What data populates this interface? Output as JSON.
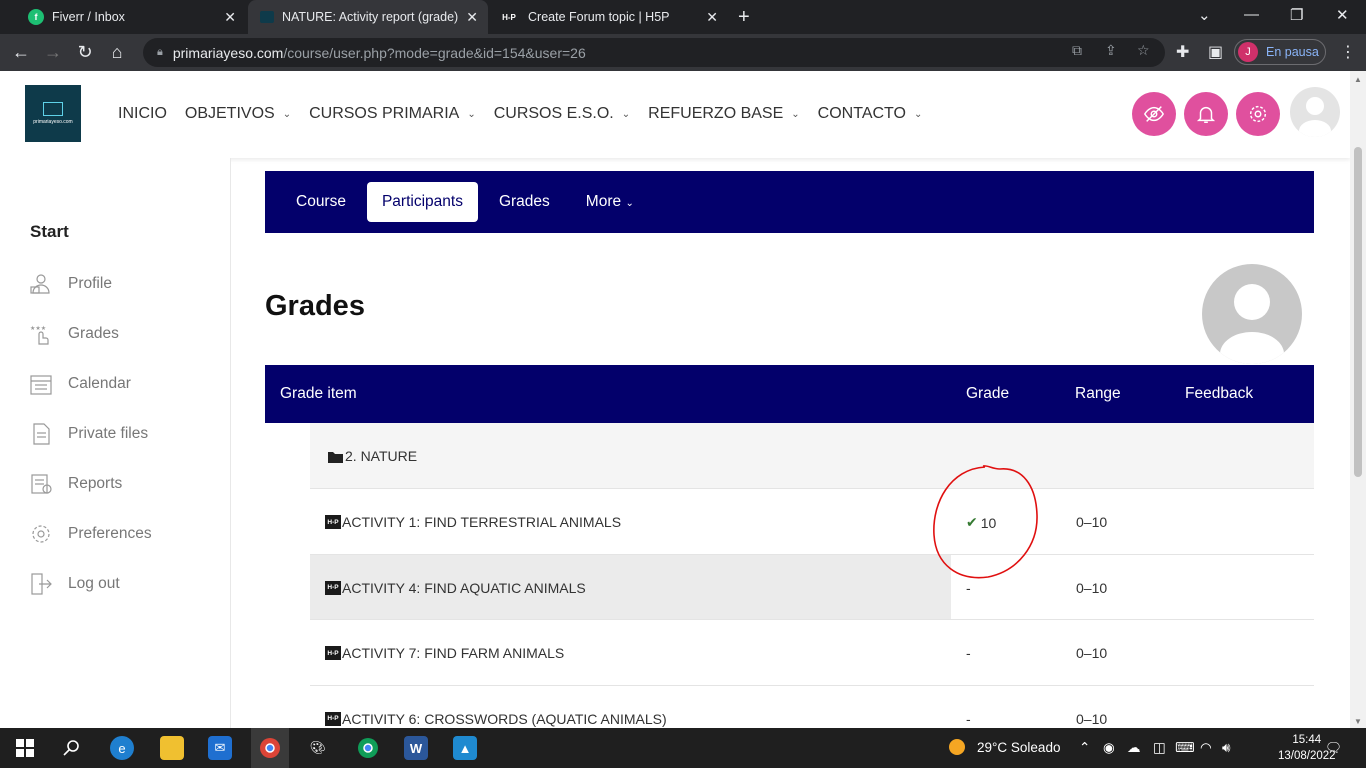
{
  "browser": {
    "tabs": [
      {
        "title": "Fiverr / Inbox",
        "favicon": "fi"
      },
      {
        "title": "NATURE: Activity report (grade)",
        "favicon": "site"
      },
      {
        "title": "Create Forum topic | H5P",
        "favicon": "H-P"
      }
    ],
    "url_host": "primariayeso.com",
    "url_path": "/course/user.php?mode=grade&id=154&user=26",
    "profile_initial": "J",
    "profile_status": "En pausa"
  },
  "site": {
    "logo_text": "primariayeso.com",
    "nav": [
      {
        "label": "INICIO",
        "has_menu": false
      },
      {
        "label": "OBJETIVOS",
        "has_menu": true
      },
      {
        "label": "CURSOS PRIMARIA",
        "has_menu": true
      },
      {
        "label": "CURSOS E.S.O.",
        "has_menu": true
      },
      {
        "label": "REFUERZO BASE",
        "has_menu": true
      },
      {
        "label": "CONTACTO",
        "has_menu": true
      }
    ],
    "accent_color": "#e0509e"
  },
  "sidebar": {
    "heading": "Start",
    "items": [
      {
        "label": "Profile",
        "icon": "profile-icon"
      },
      {
        "label": "Grades",
        "icon": "grades-icon"
      },
      {
        "label": "Calendar",
        "icon": "calendar-icon"
      },
      {
        "label": "Private files",
        "icon": "file-icon"
      },
      {
        "label": "Reports",
        "icon": "reports-icon"
      },
      {
        "label": "Preferences",
        "icon": "gear-icon"
      },
      {
        "label": "Log out",
        "icon": "logout-icon"
      }
    ]
  },
  "secondary_nav": {
    "items": [
      {
        "label": "Course",
        "active": false
      },
      {
        "label": "Participants",
        "active": true
      },
      {
        "label": "Grades",
        "active": false
      },
      {
        "label": "More",
        "active": false
      }
    ],
    "color": "#03006b"
  },
  "page": {
    "title": "Grades"
  },
  "grade_table": {
    "headers": {
      "item": "Grade item",
      "grade": "Grade",
      "range": "Range",
      "feedback": "Feedback"
    },
    "category": "2. NATURE",
    "rows": [
      {
        "name": "ACTIVITY 1: FIND TERRESTRIAL ANIMALS",
        "grade": "10",
        "graded": true,
        "range": "0–10"
      },
      {
        "name": "ACTIVITY 4: FIND AQUATIC ANIMALS",
        "grade": "-",
        "graded": false,
        "range": "0–10"
      },
      {
        "name": "ACTIVITY 7: FIND FARM ANIMALS",
        "grade": "-",
        "graded": false,
        "range": "0–10"
      },
      {
        "name": "ACTIVITY 6: CROSSWORDS (AQUATIC ANIMALS)",
        "grade": "-",
        "graded": false,
        "range": "0–10"
      }
    ]
  },
  "taskbar": {
    "weather": "29°C  Soleado",
    "time": "15:44",
    "date": "13/08/2022"
  }
}
